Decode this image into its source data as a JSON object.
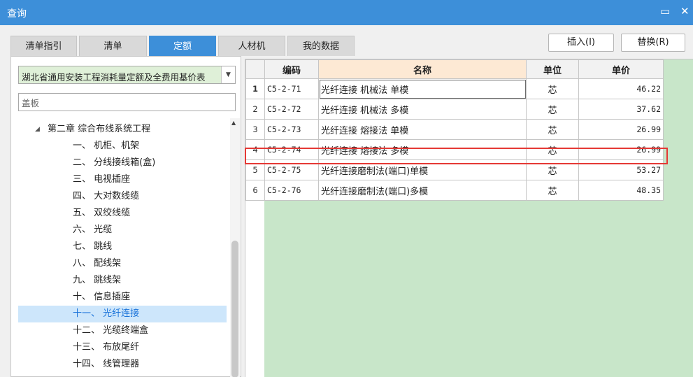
{
  "window": {
    "title": "查询",
    "minimize_glyph": "▭",
    "close_glyph": "✕"
  },
  "tabs": [
    {
      "label": "清单指引",
      "active": false
    },
    {
      "label": "清单",
      "active": false
    },
    {
      "label": "定额",
      "active": true
    },
    {
      "label": "人材机",
      "active": false
    },
    {
      "label": "我的数据",
      "active": false
    }
  ],
  "toolbar": {
    "insert_label": "插入(I)",
    "replace_label": "替换(R)"
  },
  "left": {
    "library_selected": "湖北省通用安装工程消耗量定额及全费用基价表",
    "search_value": "盖板",
    "tree": [
      {
        "label": "第二章 综合布线系统工程",
        "expander": "◢",
        "selected": false
      },
      {
        "label": "一、 机柜、机架",
        "selected": false
      },
      {
        "label": "二、 分线接线箱(盒)",
        "selected": false
      },
      {
        "label": "三、 电视插座",
        "selected": false
      },
      {
        "label": "四、 大对数线缆",
        "selected": false
      },
      {
        "label": "五、 双绞线缆",
        "selected": false
      },
      {
        "label": "六、 光缆",
        "selected": false
      },
      {
        "label": "七、 跳线",
        "selected": false
      },
      {
        "label": "八、 配线架",
        "selected": false
      },
      {
        "label": "九、 跳线架",
        "selected": false
      },
      {
        "label": "十、 信息插座",
        "selected": false
      },
      {
        "label": "十一、 光纤连接",
        "selected": true
      },
      {
        "label": "十二、 光缆终端盒",
        "selected": false
      },
      {
        "label": "十三、 布放尾纤",
        "selected": false
      },
      {
        "label": "十四、 线管理器",
        "selected": false
      }
    ],
    "scroll_up_glyph": "▲"
  },
  "grid": {
    "headers": {
      "code": "编码",
      "name": "名称",
      "unit": "单位",
      "price": "单价"
    },
    "rows": [
      {
        "num": "1",
        "code": "C5-2-71",
        "name": "光纤连接 机械法 单模",
        "unit": "芯",
        "price": "46.22"
      },
      {
        "num": "2",
        "code": "C5-2-72",
        "name": "光纤连接 机械法 多模",
        "unit": "芯",
        "price": "37.62"
      },
      {
        "num": "3",
        "code": "C5-2-73",
        "name": "光纤连接 熔接法 单模",
        "unit": "芯",
        "price": "26.99"
      },
      {
        "num": "4",
        "code": "C5-2-74",
        "name": "光纤连接 熔接法 多模",
        "unit": "芯",
        "price": "26.99"
      },
      {
        "num": "5",
        "code": "C5-2-75",
        "name": "光纤连接磨制法(端口)单模",
        "unit": "芯",
        "price": "53.27"
      },
      {
        "num": "6",
        "code": "C5-2-76",
        "name": "光纤连接磨制法(端口)多模",
        "unit": "芯",
        "price": "48.35"
      }
    ]
  },
  "colors": {
    "accent": "#3d8fd9",
    "grid_background": "#c8e6c9",
    "highlight_box": "#e53935",
    "selected_tree_item": "#cde6fb"
  }
}
